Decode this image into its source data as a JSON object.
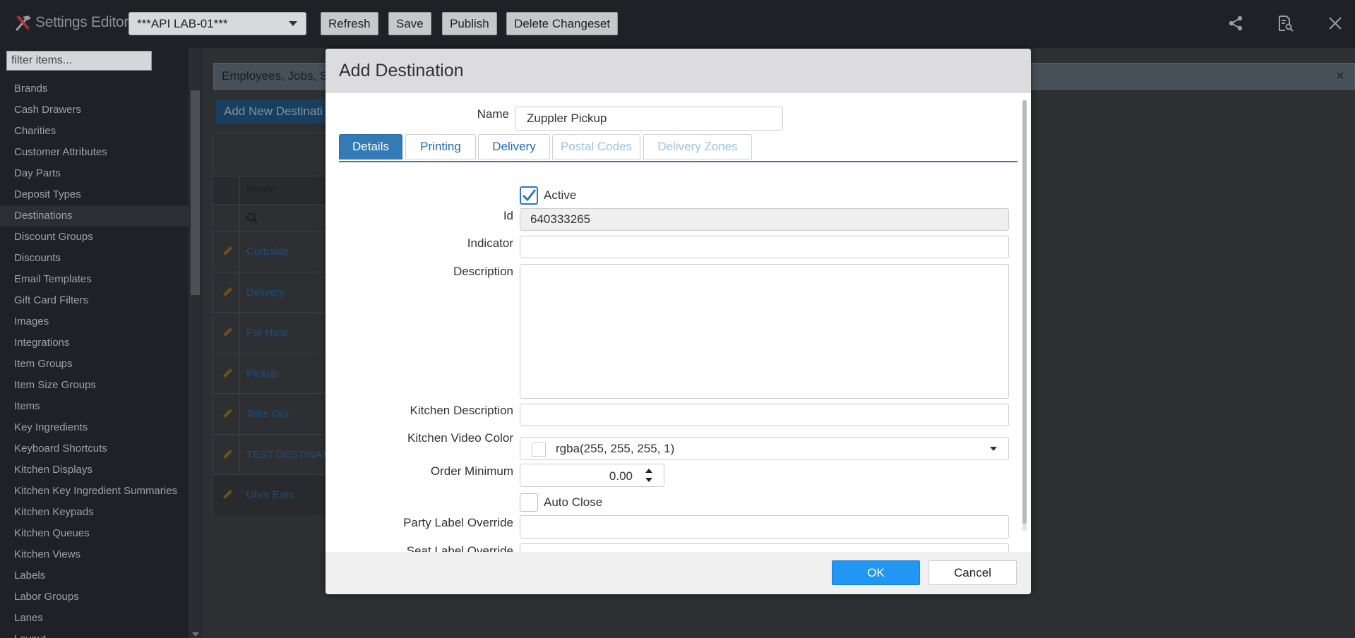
{
  "app": {
    "title": "Settings Editor",
    "location": "***API LAB-01***",
    "buttons": {
      "refresh": "Refresh",
      "save": "Save",
      "publish": "Publish",
      "delete_changeset": "Delete Changeset"
    }
  },
  "sidebar": {
    "filter_placeholder": "filter items...",
    "items": [
      {
        "label": "Brands"
      },
      {
        "label": "Cash Drawers"
      },
      {
        "label": "Charities"
      },
      {
        "label": "Customer Attributes"
      },
      {
        "label": "Day Parts"
      },
      {
        "label": "Deposit Types"
      },
      {
        "label": "Destinations"
      },
      {
        "label": "Discount Groups"
      },
      {
        "label": "Discounts"
      },
      {
        "label": "Email Templates"
      },
      {
        "label": "Gift Card Filters"
      },
      {
        "label": "Images"
      },
      {
        "label": "Integrations"
      },
      {
        "label": "Item Groups"
      },
      {
        "label": "Item Size Groups"
      },
      {
        "label": "Items"
      },
      {
        "label": "Key Ingredients"
      },
      {
        "label": "Keyboard Shortcuts"
      },
      {
        "label": "Kitchen Displays"
      },
      {
        "label": "Kitchen Key Ingredient Summaries"
      },
      {
        "label": "Kitchen Keypads"
      },
      {
        "label": "Kitchen Queues"
      },
      {
        "label": "Kitchen Views"
      },
      {
        "label": "Labels"
      },
      {
        "label": "Labor Groups"
      },
      {
        "label": "Lanes"
      },
      {
        "label": "Layout"
      }
    ],
    "active": "Destinations"
  },
  "main": {
    "info_text": "Employees, Jobs, Se",
    "add_button": "Add New Destinati",
    "grid": {
      "column_name": "Name",
      "rows": [
        "Curbside",
        "Delivery",
        "For Here",
        "Pickup",
        "Take Out",
        "TEST DESTINATIO",
        "Uber Eats"
      ]
    }
  },
  "modal": {
    "title": "Add Destination",
    "name_label": "Name",
    "name_value": "Zuppler Pickup",
    "tabs": [
      {
        "label": "Details",
        "state": "active"
      },
      {
        "label": "Printing",
        "state": "normal"
      },
      {
        "label": "Delivery",
        "state": "normal"
      },
      {
        "label": "Postal Codes",
        "state": "disabled"
      },
      {
        "label": "Delivery Zones",
        "state": "disabled"
      }
    ],
    "fields": {
      "active_label": "Active",
      "active_checked": true,
      "id_label": "Id",
      "id_value": "640333265",
      "indicator_label": "Indicator",
      "indicator_value": "",
      "description_label": "Description",
      "description_value": "",
      "kitchen_description_label": "Kitchen Description",
      "kitchen_description_value": "",
      "kitchen_video_color_label": "Kitchen Video Color",
      "kitchen_video_color_value": "rgba(255, 255, 255, 1)",
      "order_minimum_label": "Order Minimum",
      "order_minimum_value": "0.00",
      "auto_close_label": "Auto Close",
      "auto_close_checked": false,
      "party_label_override_label": "Party Label Override",
      "party_label_override_value": "",
      "seat_label_override_label": "Seat Label Override"
    },
    "ok_label": "OK",
    "cancel_label": "Cancel"
  },
  "colors": {
    "primary": "#337ab7",
    "ok_button": "#2196f3",
    "link": "#1f6cb0"
  }
}
